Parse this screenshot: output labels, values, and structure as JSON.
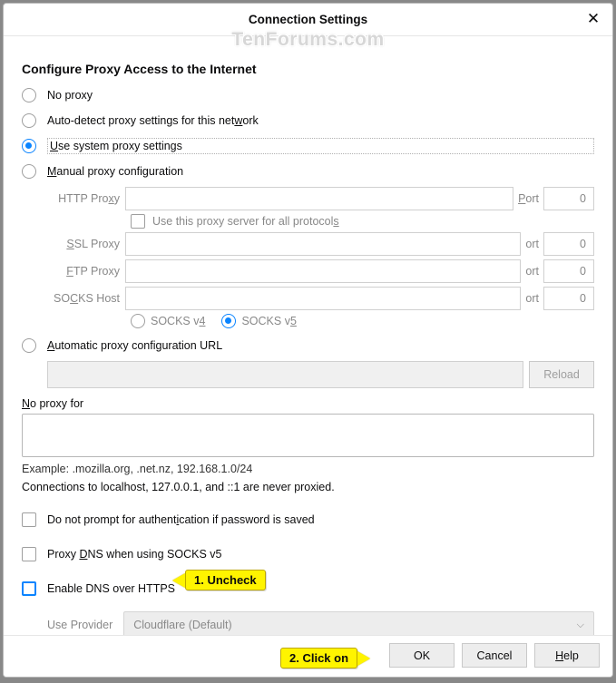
{
  "watermark": "TenForums.com",
  "dialog": {
    "title": "Connection Settings",
    "heading": "Configure Proxy Access to the Internet"
  },
  "radios": {
    "no_proxy": "No proxy",
    "auto_detect_pre": "Auto-detect proxy settings for this net",
    "auto_detect_ul": "w",
    "auto_detect_post": "ork",
    "use_system_ul": "U",
    "use_system_post": "se system proxy settings",
    "manual_ul": "M",
    "manual_post": "anual proxy configuration",
    "auto_url_ul": "A",
    "auto_url_post": "utomatic proxy configuration URL"
  },
  "fields": {
    "http_label_pre": "HTTP Pro",
    "http_ul": "x",
    "http_label_post": "y",
    "ssl_ul": "S",
    "ssl_label": "SL Proxy",
    "ftp_ul": "F",
    "ftp_label": "TP Proxy",
    "socks_label_pre": "SO",
    "socks_ul": "C",
    "socks_label_post": "KS Host",
    "port_ul": "P",
    "port": "ort",
    "port_value": "0",
    "same_protocols_ul": "s",
    "same_protocols_pre": "Use this proxy server for all protocol",
    "socks_v4": "4",
    "socks_v4_pre": "SOCKS v",
    "socks_v5": "5",
    "socks_v5_pre": "SOCKS v",
    "reload": "Reload",
    "no_proxy_for_ul": "N",
    "no_proxy_for": "o proxy for",
    "example": "Example: .mozilla.org, .net.nz, 192.168.1.0/24",
    "hint": "Connections to localhost, 127.0.0.1, and ::1 are never proxied."
  },
  "checks": {
    "no_prompt_pre": "Do not prompt for authent",
    "no_prompt_ul": "i",
    "no_prompt_post": "cation if password is saved",
    "proxy_dns_pre": "Proxy ",
    "proxy_dns_ul": "D",
    "proxy_dns_post": "NS when using SOCKS v5",
    "enable_doh": "Enable DNS over HTTPS"
  },
  "provider": {
    "label": "Use Provider",
    "value": "Cloudflare (Default)"
  },
  "buttons": {
    "ok": "OK",
    "cancel": "Cancel",
    "help_ul": "H",
    "help": "elp"
  },
  "callouts": {
    "uncheck": "1. Uncheck",
    "clickon": "2. Click on"
  }
}
